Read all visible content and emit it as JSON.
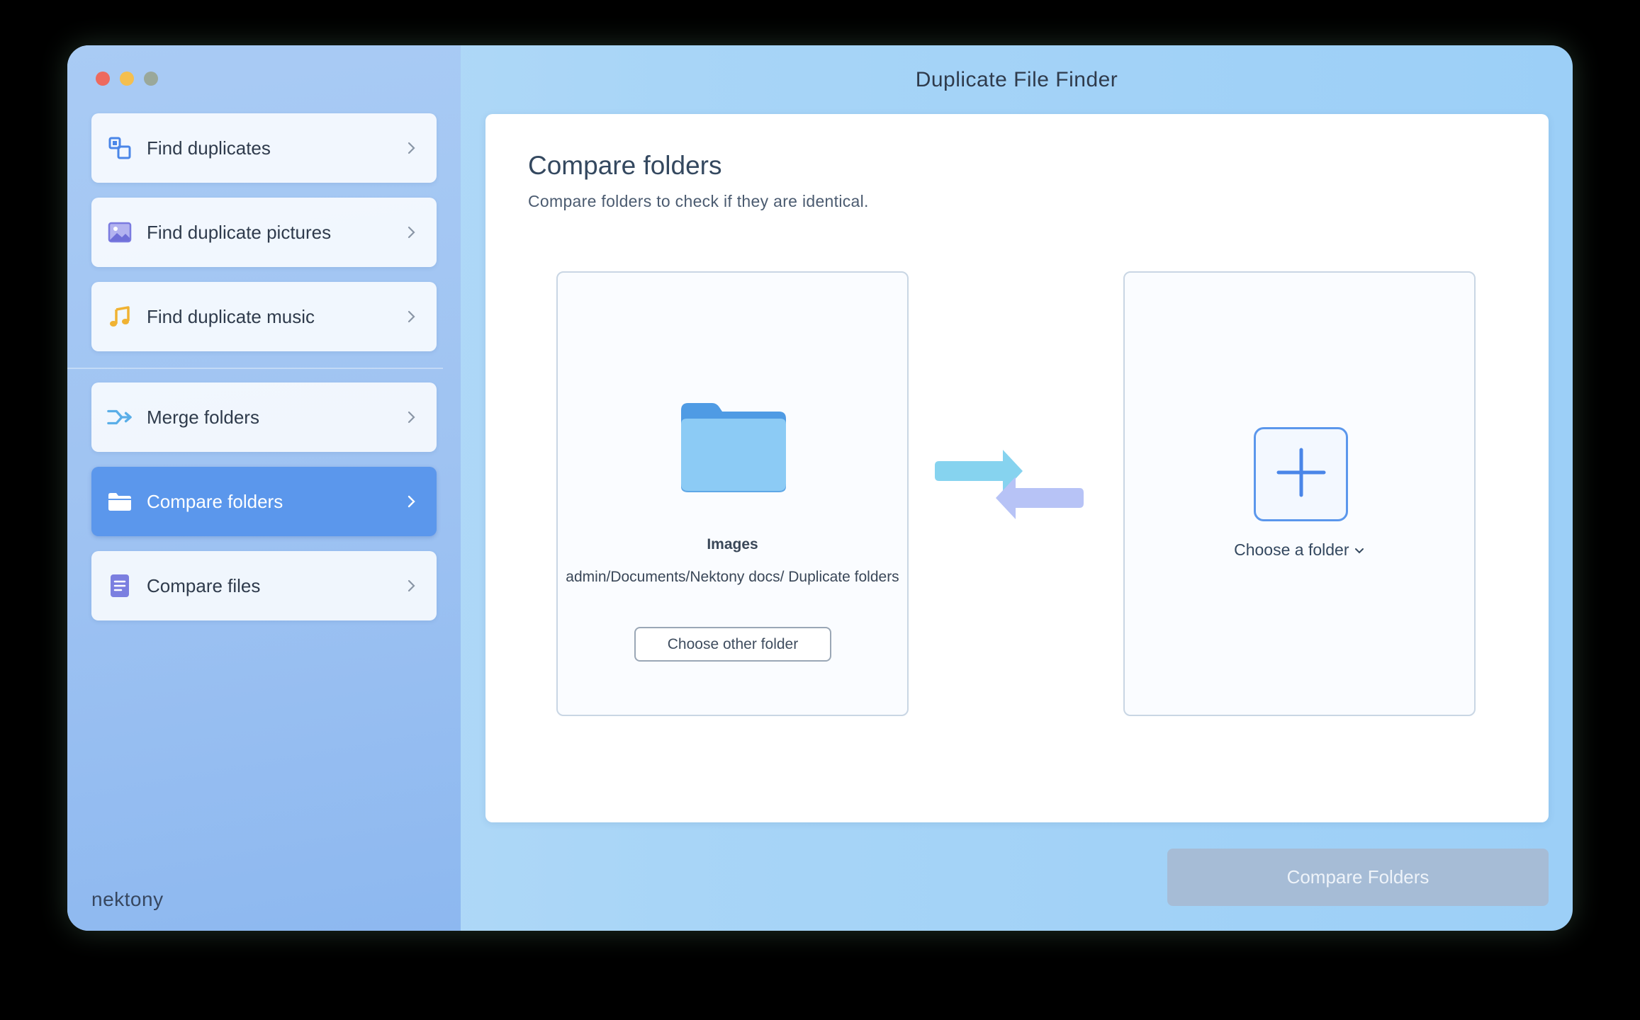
{
  "window": {
    "title": "Duplicate File Finder"
  },
  "sidebar": {
    "items": [
      {
        "label": "Find duplicates",
        "icon": "duplicates-icon"
      },
      {
        "label": "Find duplicate pictures",
        "icon": "picture-icon"
      },
      {
        "label": "Find duplicate music",
        "icon": "music-note-icon"
      },
      {
        "label": "Merge folders",
        "icon": "merge-icon"
      },
      {
        "label": "Compare folders",
        "icon": "folder-open-icon",
        "active": true
      },
      {
        "label": "Compare files",
        "icon": "document-icon"
      }
    ],
    "brand": "nektony"
  },
  "main": {
    "heading": "Compare folders",
    "subtitle": "Compare folders to check if they are identical.",
    "left_folder": {
      "name": "Images",
      "path": "admin/Documents/Nektony docs/ Duplicate folders",
      "choose_other_label": "Choose other folder"
    },
    "right_folder": {
      "choose_label": "Choose a folder"
    },
    "compare_button_label": "Compare Folders"
  },
  "colors": {
    "accent": "#5b97ec",
    "disabled_button": "#a6bcd6"
  }
}
